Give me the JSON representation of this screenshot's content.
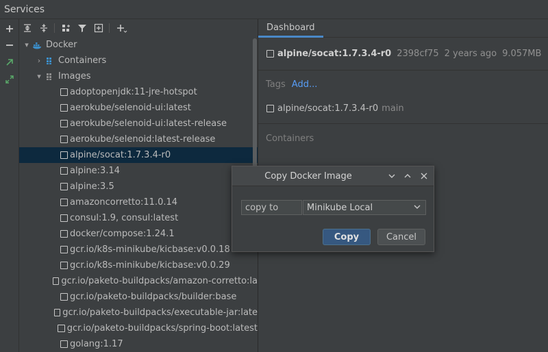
{
  "window": {
    "title": "Services"
  },
  "toolbar": {
    "icons": [
      "expand-all-icon",
      "collapse-all-icon",
      "group-by-icon",
      "filter-icon",
      "new-tab-icon",
      "add-icon"
    ]
  },
  "left_tools": {
    "icons": [
      "add-icon",
      "remove-icon",
      "green-arrow-icon",
      "green-arrow-double-icon"
    ]
  },
  "tree": {
    "root": "Docker",
    "containers": "Containers",
    "images": "Images",
    "items": [
      "adoptopenjdk:11-jre-hotspot",
      "aerokube/selenoid-ui:latest",
      "aerokube/selenoid-ui:latest-release",
      "aerokube/selenoid:latest-release",
      "alpine/socat:1.7.3.4-r0",
      "alpine:3.14",
      "alpine:3.5",
      "amazoncorretto:11.0.14",
      "consul:1.9, consul:latest",
      "docker/compose:1.24.1",
      "gcr.io/k8s-minikube/kicbase:v0.0.18",
      "gcr.io/k8s-minikube/kicbase:v0.0.29",
      "gcr.io/paketo-buildpacks/amazon-corretto:la",
      "gcr.io/paketo-buildpacks/builder:base",
      "gcr.io/paketo-buildpacks/executable-jar:late",
      "gcr.io/paketo-buildpacks/spring-boot:latest",
      "golang:1.17"
    ],
    "selected_index": 4
  },
  "details": {
    "tab": "Dashboard",
    "image_name": "alpine/socat:1.7.3.4-r0",
    "image_id": "2398cf75",
    "age": "2 years ago",
    "size": "9.057MB",
    "tags_label": "Tags",
    "add_label": "Add...",
    "tag_name": "alpine/socat:1.7.3.4-r0",
    "tag_branch": "main",
    "containers_label": "Containers"
  },
  "dialog": {
    "title": "Copy Docker Image",
    "field_label": "copy to",
    "selected_target": "Minikube Local",
    "ok_label": "Copy",
    "cancel_label": "Cancel"
  },
  "colors": {
    "selection": "#0d293e",
    "accent": "#4a88c7",
    "link": "#589df6",
    "primary_button": "#365880"
  }
}
